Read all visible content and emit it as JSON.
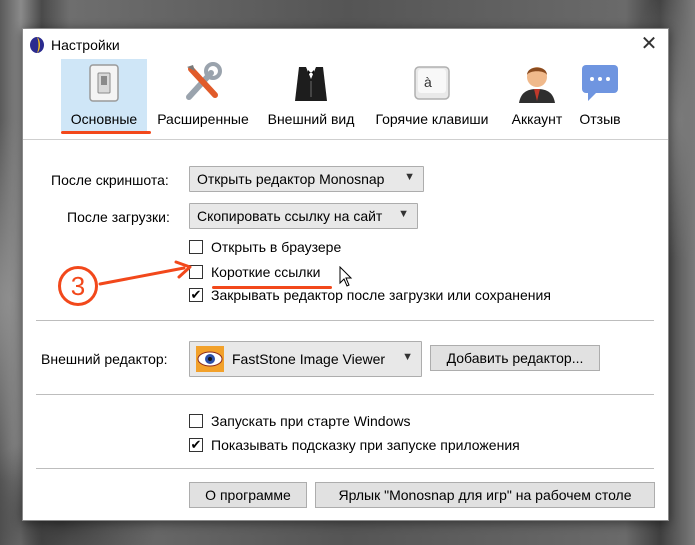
{
  "window": {
    "title": "Настройки"
  },
  "tabs": [
    {
      "label": "Основные"
    },
    {
      "label": "Расширенные"
    },
    {
      "label": "Внешний вид"
    },
    {
      "label": "Горячие клавиши"
    },
    {
      "label": "Аккаунт"
    },
    {
      "label": "Отзыв"
    }
  ],
  "general": {
    "after_screenshot_label": "После скриншота:",
    "after_screenshot_value": "Открыть редактор Monosnap",
    "after_upload_label": "После загрузки:",
    "after_upload_value": "Скопировать ссылку на сайт",
    "open_in_browser": "Открыть в браузере",
    "short_links": "Короткие ссылки",
    "close_editor": "Закрывать редактор после загрузки или сохранения",
    "external_editor_label": "Внешний редактор:",
    "external_editor_value": "FastStone Image Viewer",
    "add_editor_button": "Добавить редактор...",
    "launch_at_startup": "Запускать при старте Windows",
    "show_hint": "Показывать подсказку при запуске приложения",
    "about_button": "О программе",
    "shortcut_button": "Ярлык \"Monosnap для игр\" на рабочем столе"
  },
  "checkboxes": {
    "open_in_browser": false,
    "short_links": false,
    "close_editor": true,
    "launch_at_startup": false,
    "show_hint": true
  },
  "annotation": {
    "step_number": "3"
  },
  "colors": {
    "annotation": "#f2481b",
    "active_tab": "#cfe6f7"
  }
}
